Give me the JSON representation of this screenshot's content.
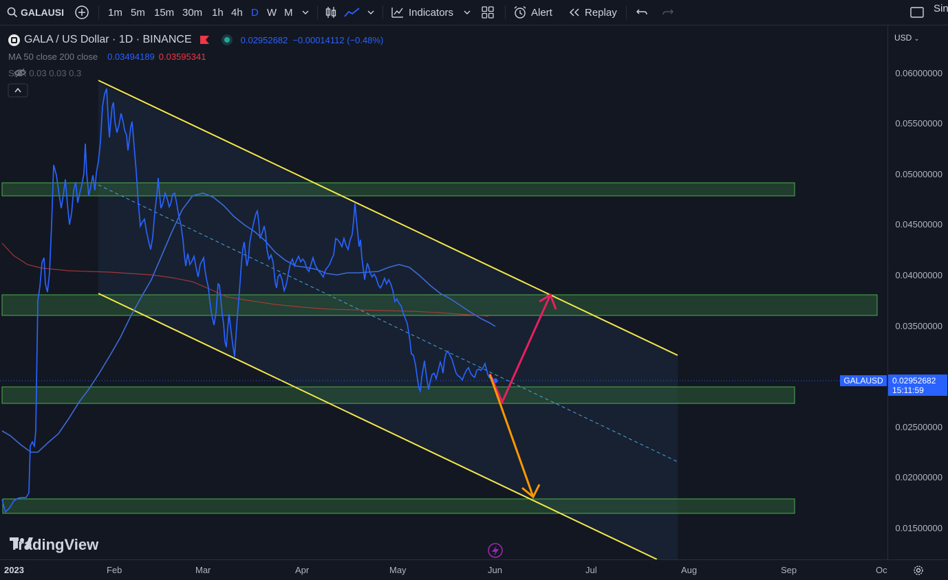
{
  "toolbar": {
    "symbol": "GALAUSI",
    "intervals": [
      "1m",
      "5m",
      "15m",
      "30m",
      "1h",
      "4h",
      "D",
      "W",
      "M"
    ],
    "selected_interval": "D",
    "indicators_label": "Indicators",
    "alert_label": "Alert",
    "replay_label": "Replay",
    "right_partial": "Sin"
  },
  "legend": {
    "title": "GALA / US Dollar · 1D · BINANCE",
    "last_price": "0.02952682",
    "change": "−0.00014112 (−0.48%)",
    "ma_label": "MA 50 close 200 close",
    "ma50_value": "0.03494189",
    "ma200_value": "0.03595341",
    "sar_label": "SAR 0.03 0.03 0.3",
    "collapse_icon": "chevron-up-icon"
  },
  "price_axis": {
    "currency": "USD",
    "ticks": [
      "0.06000000",
      "0.05500000",
      "0.05000000",
      "0.04500000",
      "0.04000000",
      "0.03500000",
      "0.02500000",
      "0.02000000",
      "0.01500000"
    ],
    "symbol_tag": "GALAUSD",
    "current_price": "0.02952682",
    "countdown": "15:11:59"
  },
  "time_axis": {
    "labels": [
      "2023",
      "Feb",
      "Mar",
      "Apr",
      "May",
      "Jun",
      "Jul",
      "Aug",
      "Sep",
      "Oc"
    ]
  },
  "watermark": "TradingView",
  "colors": {
    "background": "#131722",
    "price_line": "#2962ff",
    "channel": "#f5e94b",
    "zone_fill": "#2e5d36",
    "zone_border": "#4caf50",
    "up_arrow": "#e91e63",
    "down_arrow": "#ff9800",
    "ma200": "#b83b3b"
  }
}
